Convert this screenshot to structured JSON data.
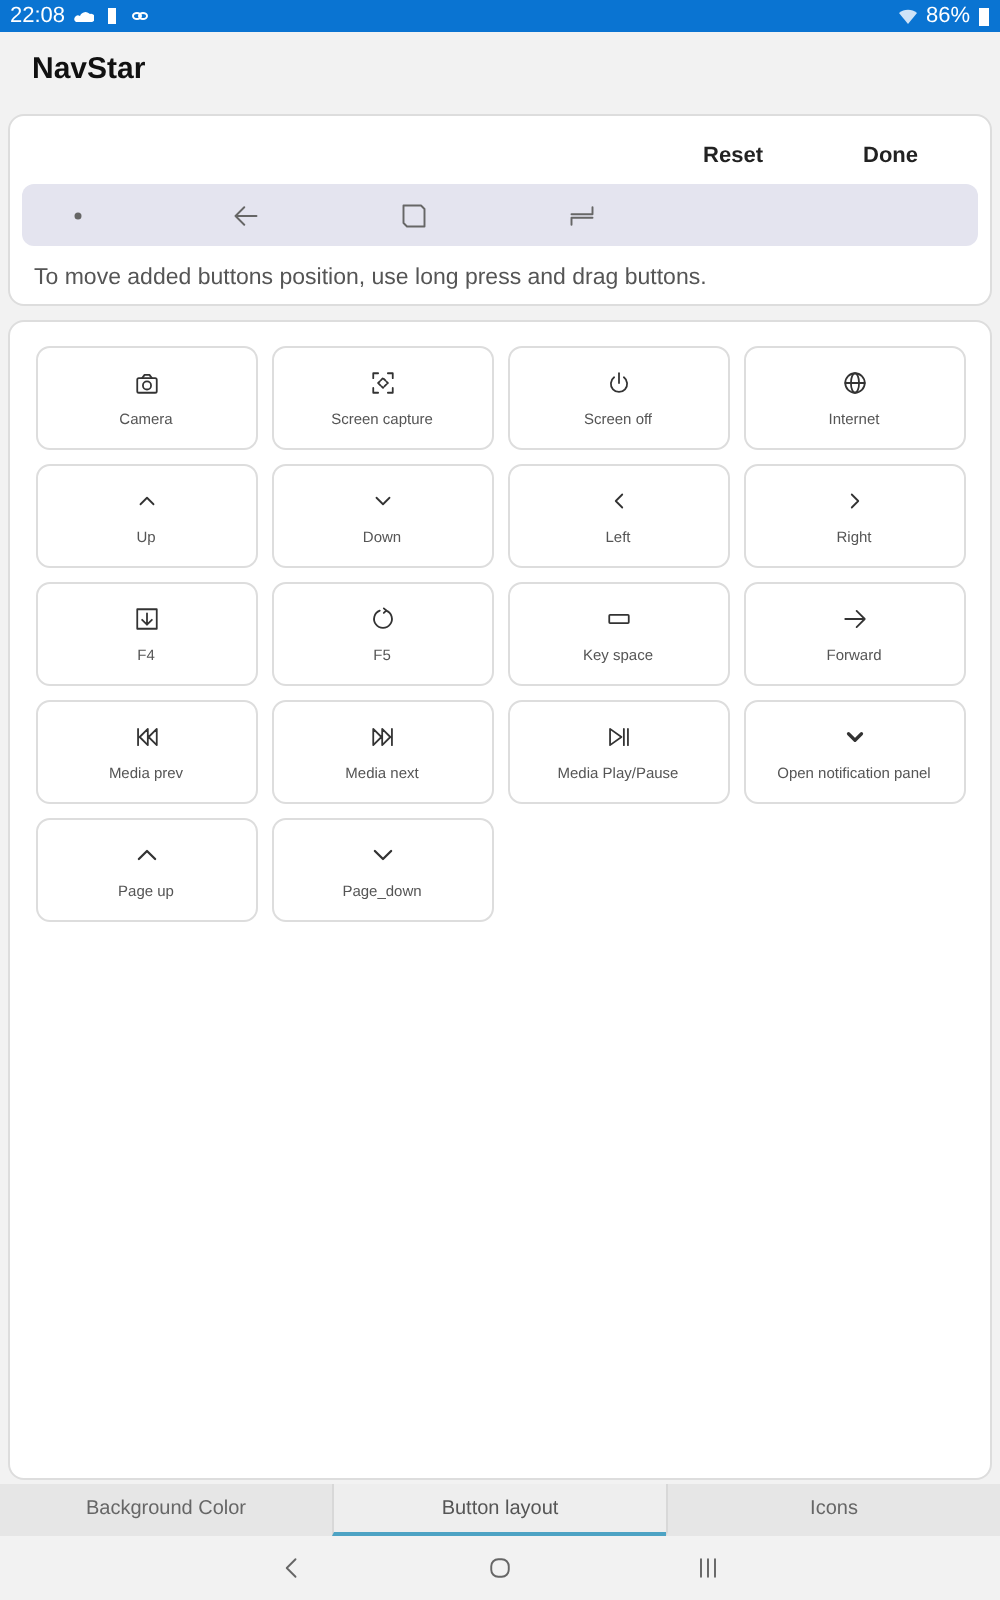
{
  "status_bar": {
    "time": "22:08",
    "battery": "86%"
  },
  "app_bar": {
    "title": "NavStar"
  },
  "editor": {
    "actions": [
      "Reset",
      "Done"
    ],
    "preview_buttons": [
      {
        "kind": "dot"
      },
      {
        "kind": "back"
      },
      {
        "kind": "home"
      },
      {
        "kind": "recents"
      }
    ],
    "hint": "To move added buttons position, use long press and drag buttons."
  },
  "buttons": [
    {
      "label": "Camera",
      "kind": "camera"
    },
    {
      "label": "Screen capture",
      "kind": "capture"
    },
    {
      "label": "Screen off",
      "kind": "power"
    },
    {
      "label": "Internet",
      "kind": "globe"
    },
    {
      "label": "Up",
      "kind": "up"
    },
    {
      "label": "Down",
      "kind": "down"
    },
    {
      "label": "Left",
      "kind": "left"
    },
    {
      "label": "Right",
      "kind": "right"
    },
    {
      "label": "F4",
      "kind": "download"
    },
    {
      "label": "F5",
      "kind": "refresh"
    },
    {
      "label": "Key space",
      "kind": "space"
    },
    {
      "label": "Forward",
      "kind": "forward"
    },
    {
      "label": "Media prev",
      "kind": "prev"
    },
    {
      "label": "Media next",
      "kind": "next"
    },
    {
      "label": "Media Play/Pause",
      "kind": "playpause"
    },
    {
      "label": "Open notification panel",
      "kind": "chevron"
    },
    {
      "label": "Page up",
      "kind": "upbold"
    },
    {
      "label": "Page_down",
      "kind": "downbold"
    }
  ],
  "tabs": [
    {
      "label": "Background Color",
      "selected": false
    },
    {
      "label": "Button layout",
      "selected": true
    },
    {
      "label": "Icons",
      "selected": false
    }
  ],
  "system_nav": [
    {
      "kind": "back"
    },
    {
      "kind": "home"
    },
    {
      "kind": "recents"
    }
  ]
}
